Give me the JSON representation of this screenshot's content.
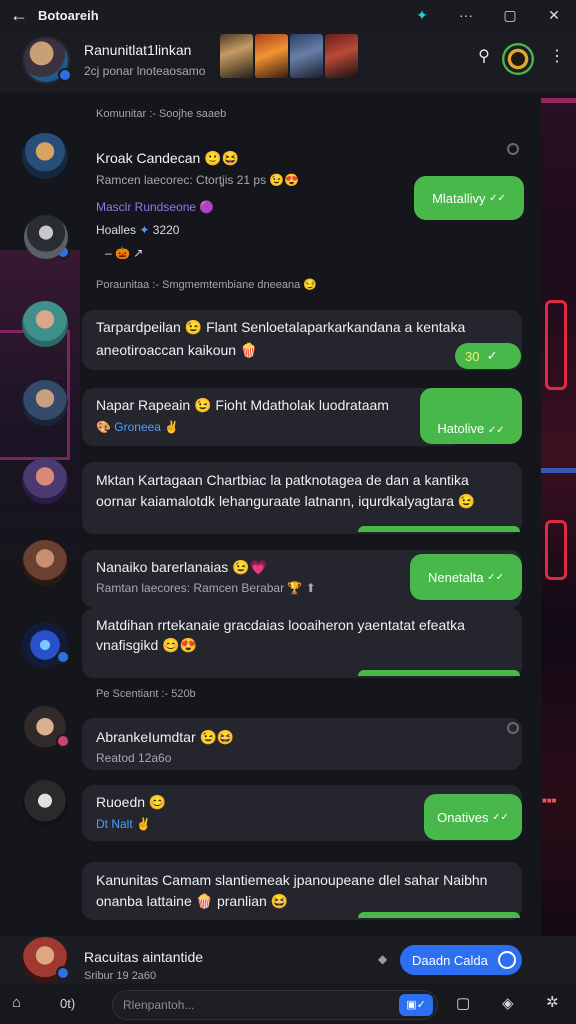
{
  "window": {
    "title": "Botoareih",
    "back_icon": "arrow-left-icon",
    "app_icon": "telegram-icon",
    "controls": [
      "menu-dots-icon",
      "maximize-icon",
      "close-icon"
    ]
  },
  "header": {
    "title": "Ranunitlat1linkan",
    "subtitle": "2cj ponar lnoteaosamo"
  },
  "separators": {
    "s1": "Komunitar :- Soojhe saaeb",
    "s2": "Poraunitaa :- Smgmemtembiane dneeana",
    "s3": "Pe Scentiant :- 520b"
  },
  "messages": {
    "m1": {
      "name": "Kroak Candecan",
      "meta": "Ramcen laecorec: Ctorţjis 21 ps",
      "line2": "Masclr Rundseone",
      "line3": "Hoalles",
      "line3b": "3220"
    },
    "m2": {
      "line1": "Tarpardpeilan",
      "line1b": "Flant Senloetalaparkarkandana a kentaka",
      "line2": "aneotiroaccan kaikoun",
      "check": "30"
    },
    "m3": {
      "name": "Napar Rapeain",
      "name_b": "Fioht Mdatholak luodrataam",
      "line2": "Groneea"
    },
    "m4": {
      "line1": "Mktan Kartagaan Chartbiac la patknotagea de dan a kantika",
      "line2": "oornar kaiamalotdk lehanguraate latnann, iqurdkalyagtara"
    },
    "m5": {
      "name": "Nanaiko barerlanaias",
      "meta": "Ramtan laecores: Ramcen Berabar"
    },
    "m6": {
      "line1": "Matdihan rrtekanaie gracdaias looaiheron yaentatat efeatka",
      "line2": "vnafisgikd"
    },
    "m7": {
      "name": "AbrankeIumdtar",
      "meta": "Reatod 12a6o"
    },
    "m8": {
      "name": "Ruoedn",
      "line2": "Dt Nalt"
    },
    "m9": {
      "line1": "Kanunitas Camam slantiemeak jpanoupeane dlel sahar Naibhn",
      "line2": "onanba lattaine",
      "line2b": "pranlian"
    }
  },
  "green_bubbles": {
    "g1": "Mlatallivy",
    "g2": "Hatolive",
    "g3": "Nenetalta",
    "g4": "Onatives"
  },
  "footer": {
    "name": "Racuitas aintantide",
    "sub": "Sribur 19 2a60",
    "button": "Daadn Calda"
  },
  "composer": {
    "placeholder": "Rlenpantoh...",
    "left_label": "0t)",
    "icons": [
      "home-icon",
      "image-icon",
      "sticker-icon",
      "settings-icon"
    ]
  },
  "colors": {
    "accent_green": "#48b84a",
    "accent_blue": "#2c6ff0",
    "bubble": "#25262d"
  }
}
